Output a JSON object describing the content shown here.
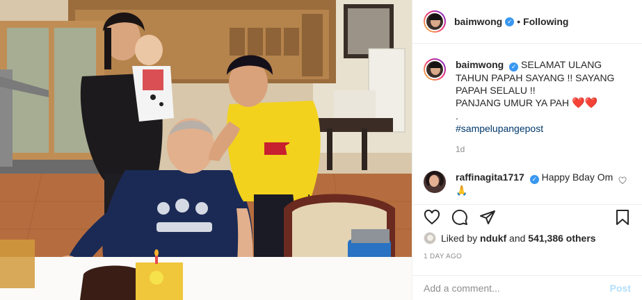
{
  "post": {
    "username": "baimwong",
    "verified": true,
    "follow_state": "Following",
    "separator": "•"
  },
  "caption": {
    "username": "baimwong",
    "lines": [
      "SELAMAT ULANG TAHUN PAPAH SAYANG !! SAYANG PAPAH SELALU !!",
      "PANJANG UMUR YA PAH",
      "."
    ],
    "emoji": "❤️❤️",
    "hashtag": "#sampelupangepost",
    "age": "1d"
  },
  "comment": {
    "username": "raffinagita1717",
    "verified": true,
    "text": "Happy Bday Om",
    "emoji": "🙏"
  },
  "likes": {
    "prefix": "Liked by",
    "user": "ndukf",
    "conjunction": "and",
    "count": "541,386 others"
  },
  "timestamp": "1 DAY AGO",
  "add_comment": {
    "placeholder": "Add a comment...",
    "post_label": "Post"
  },
  "icons": {
    "like": "heart-icon",
    "comment": "comment-icon",
    "share": "paper-plane-icon",
    "save": "bookmark-icon",
    "verified": "verified-badge-icon"
  },
  "colors": {
    "text": "#262626",
    "muted": "#8e8e8e",
    "link": "#00376b",
    "verified": "#3897f0",
    "post_disabled": "#b2dffc",
    "border": "#efefef"
  }
}
